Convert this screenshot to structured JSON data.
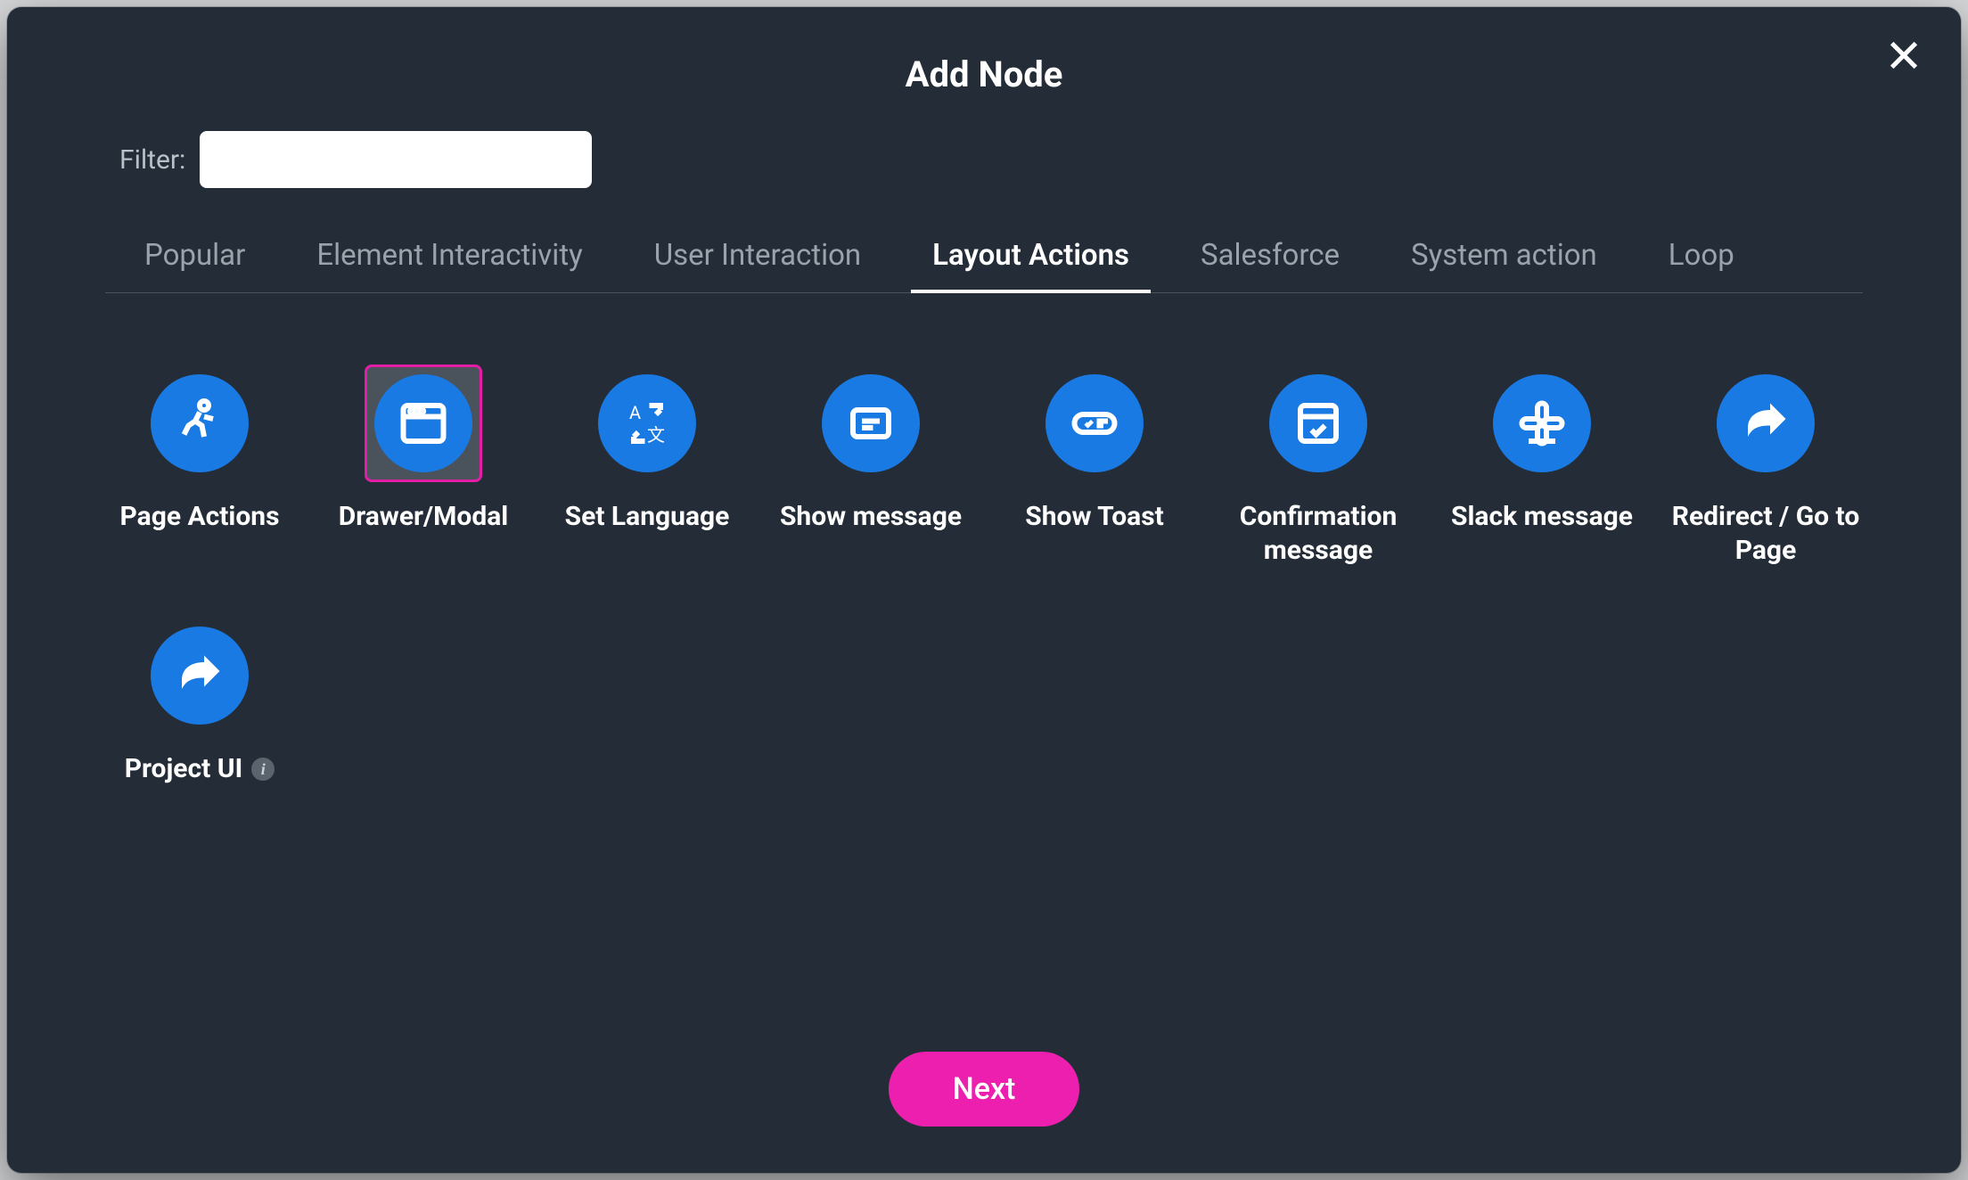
{
  "modal": {
    "title": "Add Node",
    "filter_label": "Filter:",
    "filter_value": "",
    "filter_placeholder": "",
    "next_label": "Next"
  },
  "tabs": [
    {
      "id": "popular",
      "label": "Popular",
      "active": false
    },
    {
      "id": "element-interactivity",
      "label": "Element Interactivity",
      "active": false
    },
    {
      "id": "user-interaction",
      "label": "User Interaction",
      "active": false
    },
    {
      "id": "layout-actions",
      "label": "Layout Actions",
      "active": true
    },
    {
      "id": "salesforce",
      "label": "Salesforce",
      "active": false
    },
    {
      "id": "system-action",
      "label": "System action",
      "active": false
    },
    {
      "id": "loop",
      "label": "Loop",
      "active": false
    }
  ],
  "nodes": [
    {
      "id": "page-actions",
      "label": "Page Actions",
      "icon": "running-person-icon",
      "selected": false,
      "info": false
    },
    {
      "id": "drawer-modal",
      "label": "Drawer/Modal",
      "icon": "window-icon",
      "selected": true,
      "info": false
    },
    {
      "id": "set-language",
      "label": "Set Language",
      "icon": "translate-icon",
      "selected": false,
      "info": false
    },
    {
      "id": "show-message",
      "label": "Show message",
      "icon": "message-box-icon",
      "selected": false,
      "info": false
    },
    {
      "id": "show-toast",
      "label": "Show Toast",
      "icon": "toast-icon",
      "selected": false,
      "info": false
    },
    {
      "id": "confirmation-message",
      "label": "Confirmation message",
      "icon": "check-window-icon",
      "selected": false,
      "info": false
    },
    {
      "id": "slack-message",
      "label": "Slack message",
      "icon": "slack-icon",
      "selected": false,
      "info": false
    },
    {
      "id": "redirect",
      "label": "Redirect / Go to Page",
      "icon": "share-arrow-icon",
      "selected": false,
      "info": false
    },
    {
      "id": "project-ui",
      "label": "Project UI",
      "icon": "share-arrow-icon",
      "selected": false,
      "info": true
    }
  ],
  "colors": {
    "accent": "#1a7ae3",
    "primary": "#ec1fae",
    "selection": "#e11ea5",
    "bg": "#242d37"
  }
}
